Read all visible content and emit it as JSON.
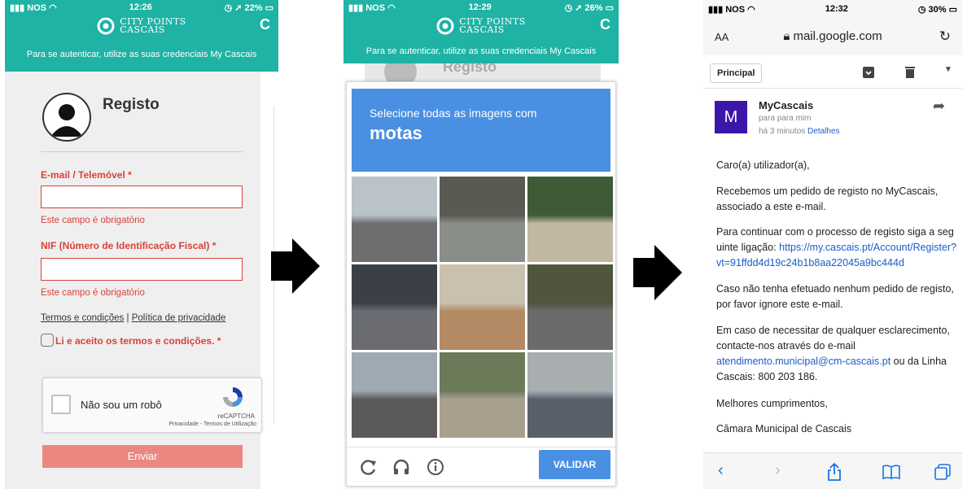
{
  "colors": {
    "teal": "#1eb3a4",
    "red": "#d9413a",
    "blue": "#4a90e2",
    "link": "#1a5dc9"
  },
  "panel1": {
    "status": {
      "carrier": "NOS",
      "time": "12:26",
      "battery": "22%"
    },
    "brand": {
      "line1": "CITY POINTS",
      "line2": "CASCAIS"
    },
    "auth_text": "Para se autenticar, utilize as suas credenciais My Cascais",
    "title": "Registo",
    "email_label": "E-mail / Telemóvel *",
    "email_value": "",
    "email_error": "Este campo é obrigatório",
    "nif_label": "NIF (Número de Identificação Fiscal) *",
    "nif_value": "",
    "nif_error": "Este campo é obrigatório",
    "terms_link": "Termos e condições",
    "separator": "|",
    "privacy_link": "Política de privacidade",
    "accept_label": "Li e aceito os termos e condições. *",
    "recaptcha": {
      "label": "Não sou um robô",
      "brand": "reCAPTCHA",
      "footer": "Privacidade - Termos de Utilização"
    },
    "submit": "Enviar"
  },
  "panel2": {
    "status": {
      "carrier": "NOS",
      "time": "12:29",
      "battery": "26%"
    },
    "brand": {
      "line1": "CITY POINTS",
      "line2": "CASCAIS"
    },
    "auth_text": "Para se autenticar, utilize as suas credenciais My Cascais",
    "behind_title": "Registo",
    "instruction": "Selecione todas as imagens com",
    "target": "motas",
    "validate": "VALIDAR",
    "icons": [
      "reload-icon",
      "headphones-icon",
      "info-icon"
    ],
    "tiles": [
      {
        "sky": "#b9c3c8",
        "ground": "#6e6e70"
      },
      {
        "sky": "#5a5a52",
        "ground": "#8a8e88"
      },
      {
        "sky": "#3e5a36",
        "ground": "#c2b7a1"
      },
      {
        "sky": "#3b3f48",
        "ground": "#6a6c72"
      },
      {
        "sky": "#c9c0ae",
        "ground": "#b48a64"
      },
      {
        "sky": "#50553e",
        "ground": "#6b6c6a"
      },
      {
        "sky": "#9ea9b2",
        "ground": "#5b5a58"
      },
      {
        "sky": "#6b7a58",
        "ground": "#a89f8f"
      },
      {
        "sky": "#a8aeb0",
        "ground": "#59606a"
      }
    ]
  },
  "panel3": {
    "status": {
      "carrier": "NOS",
      "time": "12:32",
      "battery": "30%"
    },
    "address": {
      "text_size": "AA",
      "url": "mail.google.com"
    },
    "back_label": "Principal",
    "email": {
      "avatar_letter": "M",
      "sender": "MyCascais",
      "to": "para para mim",
      "time": "há 3 minutos",
      "details": "Detalhes",
      "greeting": "Caro(a) utilizador(a),",
      "p1": "Recebemos um pedido de registo no MyCascais, associado a este e-mail.",
      "p2_text": "Para continuar com o processo de registo siga a seguinte ligação:",
      "p2_link": "https://my.cascais.pt/Account/Register?vt=91ffdd4d19c24b1b8aa22045a9bc444d",
      "p3": "Caso não tenha efetuado nenhum pedido de registo, por favor ignore este e-mail.",
      "p4_text": "Em caso de necessitar de qualquer esclarecimento, contacte-nos através do e-mail",
      "p4_link": "atendimento.municipal@cm-cascais.pt",
      "p4_tail": "ou da Linha Cascais: 800 203 186.",
      "closing": "Melhores cumprimentos,",
      "signature": "Câmara Municipal de Cascais"
    }
  }
}
